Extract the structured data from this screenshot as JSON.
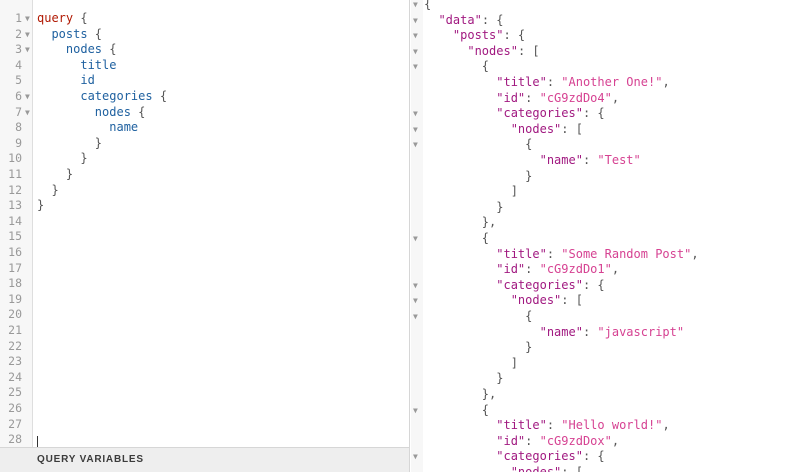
{
  "query_editor": {
    "lines": [
      {
        "n": "1",
        "fold": "▼",
        "indent": "",
        "tok": "query",
        "kind": "kw",
        "brace": " {"
      },
      {
        "n": "2",
        "fold": "▼",
        "indent": "  ",
        "tok": "posts",
        "kind": "fld",
        "brace": " {"
      },
      {
        "n": "3",
        "fold": "▼",
        "indent": "    ",
        "tok": "nodes",
        "kind": "fld",
        "brace": " {"
      },
      {
        "n": "4",
        "fold": "",
        "indent": "      ",
        "tok": "title",
        "kind": "fld",
        "brace": ""
      },
      {
        "n": "5",
        "fold": "",
        "indent": "      ",
        "tok": "id",
        "kind": "fld",
        "brace": ""
      },
      {
        "n": "6",
        "fold": "▼",
        "indent": "      ",
        "tok": "categories",
        "kind": "fld",
        "brace": " {"
      },
      {
        "n": "7",
        "fold": "▼",
        "indent": "        ",
        "tok": "nodes",
        "kind": "fld",
        "brace": " {"
      },
      {
        "n": "8",
        "fold": "",
        "indent": "          ",
        "tok": "name",
        "kind": "fld",
        "brace": ""
      },
      {
        "n": "9",
        "fold": "",
        "indent": "        ",
        "tok": "",
        "kind": "fld",
        "brace": "}"
      },
      {
        "n": "10",
        "fold": "",
        "indent": "      ",
        "tok": "",
        "kind": "fld",
        "brace": "}"
      },
      {
        "n": "11",
        "fold": "",
        "indent": "    ",
        "tok": "",
        "kind": "fld",
        "brace": "}"
      },
      {
        "n": "12",
        "fold": "",
        "indent": "  ",
        "tok": "",
        "kind": "fld",
        "brace": "}"
      },
      {
        "n": "13",
        "fold": "",
        "indent": "",
        "tok": "",
        "kind": "fld",
        "brace": "}"
      },
      {
        "n": "14",
        "fold": "",
        "indent": "",
        "tok": "",
        "kind": "fld",
        "brace": ""
      },
      {
        "n": "15",
        "fold": "",
        "indent": "",
        "tok": "",
        "kind": "fld",
        "brace": ""
      },
      {
        "n": "16",
        "fold": "",
        "indent": "",
        "tok": "",
        "kind": "fld",
        "brace": ""
      },
      {
        "n": "17",
        "fold": "",
        "indent": "",
        "tok": "",
        "kind": "fld",
        "brace": ""
      },
      {
        "n": "18",
        "fold": "",
        "indent": "",
        "tok": "",
        "kind": "fld",
        "brace": ""
      },
      {
        "n": "19",
        "fold": "",
        "indent": "",
        "tok": "",
        "kind": "fld",
        "brace": ""
      },
      {
        "n": "20",
        "fold": "",
        "indent": "",
        "tok": "",
        "kind": "fld",
        "brace": ""
      },
      {
        "n": "21",
        "fold": "",
        "indent": "",
        "tok": "",
        "kind": "fld",
        "brace": ""
      },
      {
        "n": "22",
        "fold": "",
        "indent": "",
        "tok": "",
        "kind": "fld",
        "brace": ""
      },
      {
        "n": "23",
        "fold": "",
        "indent": "",
        "tok": "",
        "kind": "fld",
        "brace": ""
      },
      {
        "n": "24",
        "fold": "",
        "indent": "",
        "tok": "",
        "kind": "fld",
        "brace": ""
      },
      {
        "n": "25",
        "fold": "",
        "indent": "",
        "tok": "",
        "kind": "fld",
        "brace": ""
      },
      {
        "n": "26",
        "fold": "",
        "indent": "",
        "tok": "",
        "kind": "fld",
        "brace": ""
      },
      {
        "n": "27",
        "fold": "",
        "indent": "",
        "tok": "",
        "kind": "fld",
        "brace": ""
      },
      {
        "n": "28",
        "fold": "",
        "indent": "",
        "tok": "",
        "kind": "fld",
        "brace": ""
      }
    ]
  },
  "query_variables": {
    "label": "QUERY VARIABLES"
  },
  "result_viewer": {
    "lines": [
      {
        "fold": "▼",
        "text": [
          {
            "t": "{",
            "c": "p"
          }
        ]
      },
      {
        "fold": "▼",
        "text": [
          {
            "t": "  ",
            "c": "p"
          },
          {
            "t": "\"data\"",
            "c": "k"
          },
          {
            "t": ": {",
            "c": "p"
          }
        ]
      },
      {
        "fold": "▼",
        "text": [
          {
            "t": "    ",
            "c": "p"
          },
          {
            "t": "\"posts\"",
            "c": "k"
          },
          {
            "t": ": {",
            "c": "p"
          }
        ]
      },
      {
        "fold": "▼",
        "text": [
          {
            "t": "      ",
            "c": "p"
          },
          {
            "t": "\"nodes\"",
            "c": "k"
          },
          {
            "t": ": [",
            "c": "p"
          }
        ]
      },
      {
        "fold": "▼",
        "text": [
          {
            "t": "        {",
            "c": "p"
          }
        ]
      },
      {
        "fold": "",
        "text": [
          {
            "t": "          ",
            "c": "p"
          },
          {
            "t": "\"title\"",
            "c": "k"
          },
          {
            "t": ": ",
            "c": "p"
          },
          {
            "t": "\"Another One!\"",
            "c": "s"
          },
          {
            "t": ",",
            "c": "p"
          }
        ]
      },
      {
        "fold": "",
        "text": [
          {
            "t": "          ",
            "c": "p"
          },
          {
            "t": "\"id\"",
            "c": "k"
          },
          {
            "t": ": ",
            "c": "p"
          },
          {
            "t": "\"cG9zdDo4\"",
            "c": "s"
          },
          {
            "t": ",",
            "c": "p"
          }
        ]
      },
      {
        "fold": "▼",
        "text": [
          {
            "t": "          ",
            "c": "p"
          },
          {
            "t": "\"categories\"",
            "c": "k"
          },
          {
            "t": ": {",
            "c": "p"
          }
        ]
      },
      {
        "fold": "▼",
        "text": [
          {
            "t": "            ",
            "c": "p"
          },
          {
            "t": "\"nodes\"",
            "c": "k"
          },
          {
            "t": ": [",
            "c": "p"
          }
        ]
      },
      {
        "fold": "▼",
        "text": [
          {
            "t": "              {",
            "c": "p"
          }
        ]
      },
      {
        "fold": "",
        "text": [
          {
            "t": "                ",
            "c": "p"
          },
          {
            "t": "\"name\"",
            "c": "k"
          },
          {
            "t": ": ",
            "c": "p"
          },
          {
            "t": "\"Test\"",
            "c": "s"
          }
        ]
      },
      {
        "fold": "",
        "text": [
          {
            "t": "              }",
            "c": "p"
          }
        ]
      },
      {
        "fold": "",
        "text": [
          {
            "t": "            ]",
            "c": "p"
          }
        ]
      },
      {
        "fold": "",
        "text": [
          {
            "t": "          }",
            "c": "p"
          }
        ]
      },
      {
        "fold": "",
        "text": [
          {
            "t": "        },",
            "c": "p"
          }
        ]
      },
      {
        "fold": "▼",
        "text": [
          {
            "t": "        {",
            "c": "p"
          }
        ]
      },
      {
        "fold": "",
        "text": [
          {
            "t": "          ",
            "c": "p"
          },
          {
            "t": "\"title\"",
            "c": "k"
          },
          {
            "t": ": ",
            "c": "p"
          },
          {
            "t": "\"Some Random Post\"",
            "c": "s"
          },
          {
            "t": ",",
            "c": "p"
          }
        ]
      },
      {
        "fold": "",
        "text": [
          {
            "t": "          ",
            "c": "p"
          },
          {
            "t": "\"id\"",
            "c": "k"
          },
          {
            "t": ": ",
            "c": "p"
          },
          {
            "t": "\"cG9zdDo1\"",
            "c": "s"
          },
          {
            "t": ",",
            "c": "p"
          }
        ]
      },
      {
        "fold": "▼",
        "text": [
          {
            "t": "          ",
            "c": "p"
          },
          {
            "t": "\"categories\"",
            "c": "k"
          },
          {
            "t": ": {",
            "c": "p"
          }
        ]
      },
      {
        "fold": "▼",
        "text": [
          {
            "t": "            ",
            "c": "p"
          },
          {
            "t": "\"nodes\"",
            "c": "k"
          },
          {
            "t": ": [",
            "c": "p"
          }
        ]
      },
      {
        "fold": "▼",
        "text": [
          {
            "t": "              {",
            "c": "p"
          }
        ]
      },
      {
        "fold": "",
        "text": [
          {
            "t": "                ",
            "c": "p"
          },
          {
            "t": "\"name\"",
            "c": "k"
          },
          {
            "t": ": ",
            "c": "p"
          },
          {
            "t": "\"javascript\"",
            "c": "s"
          }
        ]
      },
      {
        "fold": "",
        "text": [
          {
            "t": "              }",
            "c": "p"
          }
        ]
      },
      {
        "fold": "",
        "text": [
          {
            "t": "            ]",
            "c": "p"
          }
        ]
      },
      {
        "fold": "",
        "text": [
          {
            "t": "          }",
            "c": "p"
          }
        ]
      },
      {
        "fold": "",
        "text": [
          {
            "t": "        },",
            "c": "p"
          }
        ]
      },
      {
        "fold": "▼",
        "text": [
          {
            "t": "        {",
            "c": "p"
          }
        ]
      },
      {
        "fold": "",
        "text": [
          {
            "t": "          ",
            "c": "p"
          },
          {
            "t": "\"title\"",
            "c": "k"
          },
          {
            "t": ": ",
            "c": "p"
          },
          {
            "t": "\"Hello world!\"",
            "c": "s"
          },
          {
            "t": ",",
            "c": "p"
          }
        ]
      },
      {
        "fold": "",
        "text": [
          {
            "t": "          ",
            "c": "p"
          },
          {
            "t": "\"id\"",
            "c": "k"
          },
          {
            "t": ": ",
            "c": "p"
          },
          {
            "t": "\"cG9zdDox\"",
            "c": "s"
          },
          {
            "t": ",",
            "c": "p"
          }
        ]
      },
      {
        "fold": "▼",
        "text": [
          {
            "t": "          ",
            "c": "p"
          },
          {
            "t": "\"categories\"",
            "c": "k"
          },
          {
            "t": ": {",
            "c": "p"
          }
        ]
      },
      {
        "fold": "",
        "text": [
          {
            "t": "            ",
            "c": "p"
          },
          {
            "t": "\"nodes\"",
            "c": "k"
          },
          {
            "t": ": [",
            "c": "p"
          }
        ]
      }
    ]
  },
  "colors": {
    "keyword": "#b11a04",
    "field": "#1f61a0",
    "json_key": "#a11980",
    "json_string": "#d64292"
  }
}
